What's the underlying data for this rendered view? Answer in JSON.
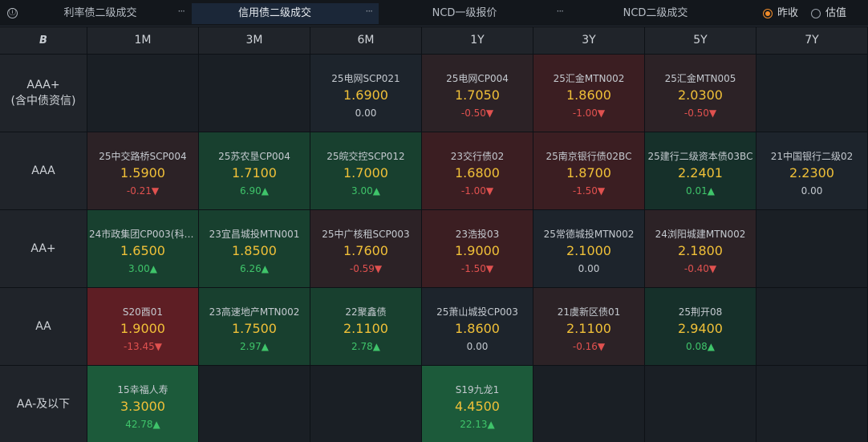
{
  "tabs": [
    {
      "label": "利率债二级成交",
      "more": "···",
      "active": false
    },
    {
      "label": "信用债二级成交",
      "more": "···",
      "active": true
    },
    {
      "label": "NCD一级报价",
      "more": "···",
      "active": false
    },
    {
      "label": "NCD二级成交",
      "more": "",
      "active": false
    }
  ],
  "info_icon": "ⓘ",
  "options": [
    {
      "label": "昨收",
      "selected": true
    },
    {
      "label": "估值",
      "selected": false
    }
  ],
  "corner_icon": "B",
  "columns": [
    "1M",
    "3M",
    "6M",
    "1Y",
    "3Y",
    "5Y",
    "7Y"
  ],
  "rows": [
    {
      "label": "AAA+\n(含中债资信)",
      "cells": [
        null,
        null,
        {
          "name": "25电网SCP021",
          "value": "1.6900",
          "change": "0.00",
          "dir": "flat"
        },
        {
          "name": "25电网CP004",
          "value": "1.7050",
          "change": "-0.50▼",
          "dir": "down"
        },
        {
          "name": "25汇金MTN002",
          "value": "1.8600",
          "change": "-1.00▼",
          "dir": "down"
        },
        {
          "name": "25汇金MTN005",
          "value": "2.0300",
          "change": "-0.50▼",
          "dir": "down"
        },
        null
      ]
    },
    {
      "label": "AAA",
      "cells": [
        {
          "name": "25中交路桥SCP004",
          "value": "1.5900",
          "change": "-0.21▼",
          "dir": "down"
        },
        {
          "name": "25苏农垦CP004",
          "value": "1.7100",
          "change": "6.90▲",
          "dir": "up"
        },
        {
          "name": "25皖交控SCP012",
          "value": "1.7000",
          "change": "3.00▲",
          "dir": "up"
        },
        {
          "name": "23交行债02",
          "value": "1.6800",
          "change": "-1.00▼",
          "dir": "down"
        },
        {
          "name": "25南京银行债02BC",
          "value": "1.8700",
          "change": "-1.50▼",
          "dir": "down"
        },
        {
          "name": "25建行二级资本债03BC",
          "value": "2.2401",
          "change": "0.01▲",
          "dir": "up"
        },
        {
          "name": "21中国银行二级02",
          "value": "2.2300",
          "change": "0.00",
          "dir": "flat"
        }
      ]
    },
    {
      "label": "AA+",
      "cells": [
        {
          "name": "24市政集团CP003(科创...",
          "value": "1.6500",
          "change": "3.00▲",
          "dir": "up"
        },
        {
          "name": "23宜昌城投MTN001",
          "value": "1.8500",
          "change": "6.26▲",
          "dir": "up"
        },
        {
          "name": "25中广核租SCP003",
          "value": "1.7600",
          "change": "-0.59▼",
          "dir": "down"
        },
        {
          "name": "23浩投03",
          "value": "1.9000",
          "change": "-1.50▼",
          "dir": "down"
        },
        {
          "name": "25常德城投MTN002",
          "value": "2.1000",
          "change": "0.00",
          "dir": "flat"
        },
        {
          "name": "24浏阳城建MTN002",
          "value": "2.1800",
          "change": "-0.40▼",
          "dir": "down"
        },
        null
      ]
    },
    {
      "label": "AA",
      "cells": [
        {
          "name": "S20酉01",
          "value": "1.9000",
          "change": "-13.45▼",
          "dir": "down"
        },
        {
          "name": "23高速地产MTN002",
          "value": "1.7500",
          "change": "2.97▲",
          "dir": "up"
        },
        {
          "name": "22聚鑫债",
          "value": "2.1100",
          "change": "2.78▲",
          "dir": "up"
        },
        {
          "name": "25萧山城投CP003",
          "value": "1.8600",
          "change": "0.00",
          "dir": "flat"
        },
        {
          "name": "21虞新区债01",
          "value": "2.1100",
          "change": "-0.16▼",
          "dir": "down"
        },
        {
          "name": "25荆开08",
          "value": "2.9400",
          "change": "0.08▲",
          "dir": "up"
        },
        null
      ]
    },
    {
      "label": "AA-及以下",
      "cells": [
        {
          "name": "15幸福人寿",
          "value": "3.3000",
          "change": "42.78▲",
          "dir": "up"
        },
        null,
        null,
        {
          "name": "S19九龙1",
          "value": "4.4500",
          "change": "22.13▲",
          "dir": "up"
        },
        null,
        null,
        null
      ]
    }
  ]
}
